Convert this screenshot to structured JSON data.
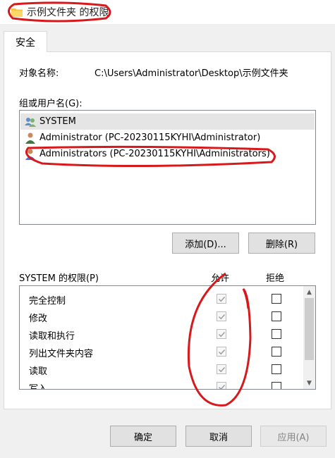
{
  "window": {
    "title": "示例文件夹 的权限"
  },
  "tabs": [
    {
      "label": "安全"
    }
  ],
  "object": {
    "label": "对象名称:",
    "value": "C:\\Users\\Administrator\\Desktop\\示例文件夹"
  },
  "groups": {
    "label": "组或用户名(G):",
    "items": [
      {
        "name": "SYSTEM",
        "icon": "system-users-icon",
        "selected": true
      },
      {
        "name": "Administrator (PC-20230115KYHI\\Administrator)",
        "icon": "user-icon",
        "selected": false
      },
      {
        "name": "Administrators (PC-20230115KYHI\\Administrators)",
        "icon": "group-icon",
        "selected": false
      }
    ]
  },
  "buttons": {
    "add": "添加(D)...",
    "remove": "删除(R)",
    "ok": "确定",
    "cancel": "取消",
    "apply": "应用(A)"
  },
  "permissions": {
    "title": "SYSTEM 的权限(P)",
    "allow_header": "允许",
    "deny_header": "拒绝",
    "rows": [
      {
        "name": "完全控制",
        "allow": true,
        "deny": false
      },
      {
        "name": "修改",
        "allow": true,
        "deny": false
      },
      {
        "name": "读取和执行",
        "allow": true,
        "deny": false
      },
      {
        "name": "列出文件夹内容",
        "allow": true,
        "deny": false
      },
      {
        "name": "读取",
        "allow": true,
        "deny": false
      },
      {
        "name": "写入",
        "allow": true,
        "deny": false
      }
    ]
  },
  "colors": {
    "annotation": "#d7191c",
    "selection": "#e5e5e5"
  }
}
